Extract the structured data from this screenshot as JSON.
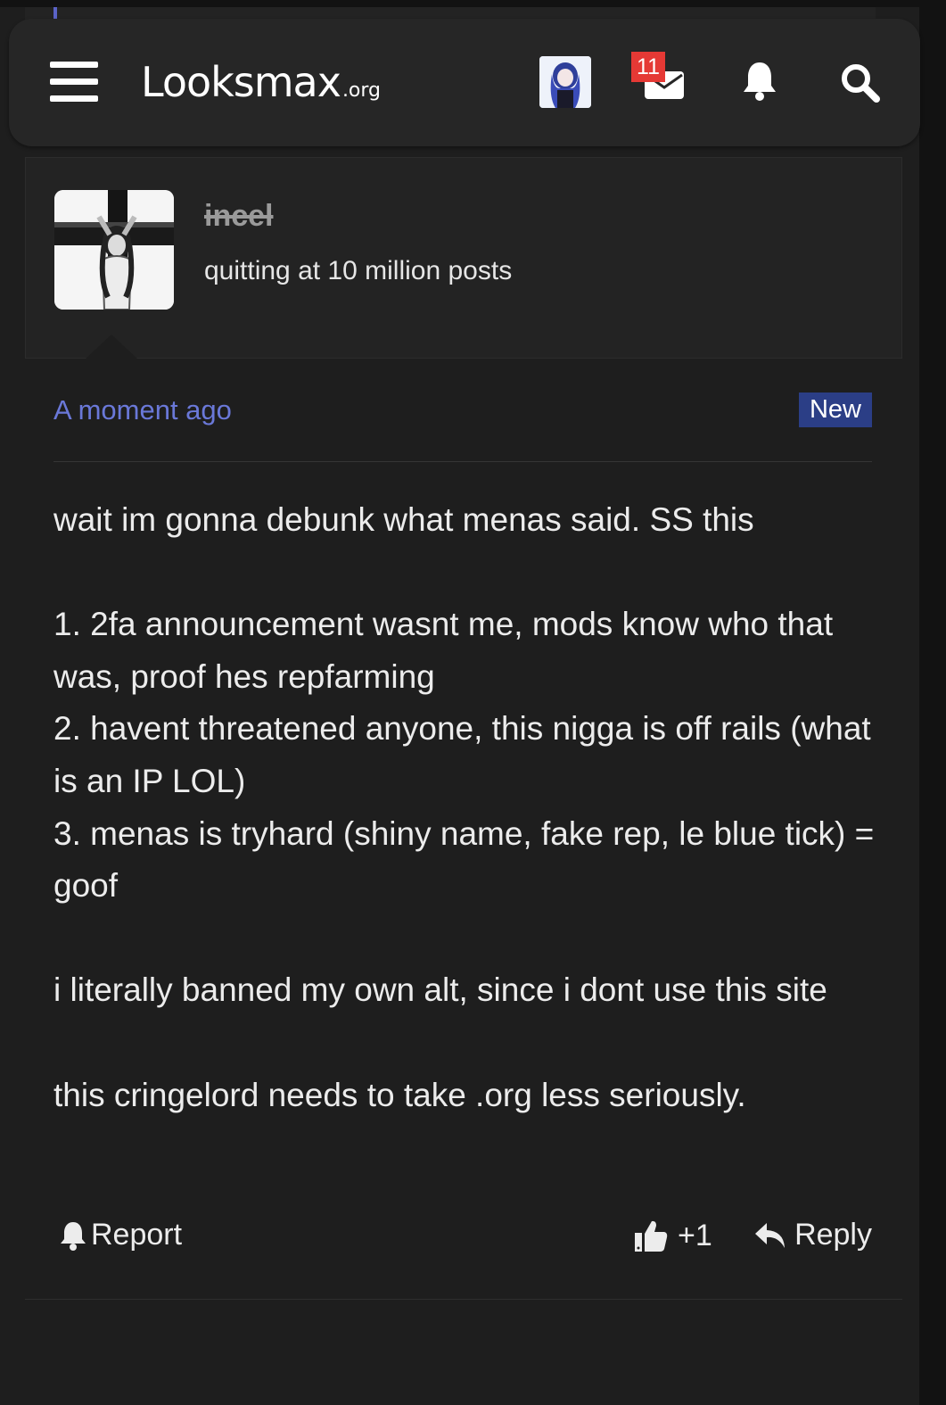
{
  "header": {
    "logo_main": "Looksmax",
    "logo_suffix": ".org",
    "mail_badge_count": "11",
    "icons": [
      "menu-icon",
      "avatar",
      "mail-icon",
      "bell-icon",
      "search-icon"
    ]
  },
  "post": {
    "username": "incel",
    "user_title": "quitting at 10 million posts",
    "timestamp": "A moment ago",
    "new_badge": "New",
    "body": [
      "wait im gonna debunk what menas said. SS this",
      "",
      "1. 2fa announcement wasnt me, mods know who that was, proof hes repfarming\n2. havent threatened anyone, this nigga is off rails (what is an IP LOL)\n3. menas is tryhard (shiny name, fake rep, le blue tick) = goof",
      "",
      "i literally banned my own alt, since i dont use this site",
      "",
      "this cringelord needs to take .org less seriously."
    ],
    "actions": {
      "report": "Report",
      "like_count": "+1",
      "reply": "Reply"
    }
  },
  "colors": {
    "background": "#1e1e1e",
    "header_bg": "#262626",
    "accent_link": "#6a78d8",
    "new_badge_bg": "#2b3e86",
    "mail_badge": "#e53935"
  }
}
